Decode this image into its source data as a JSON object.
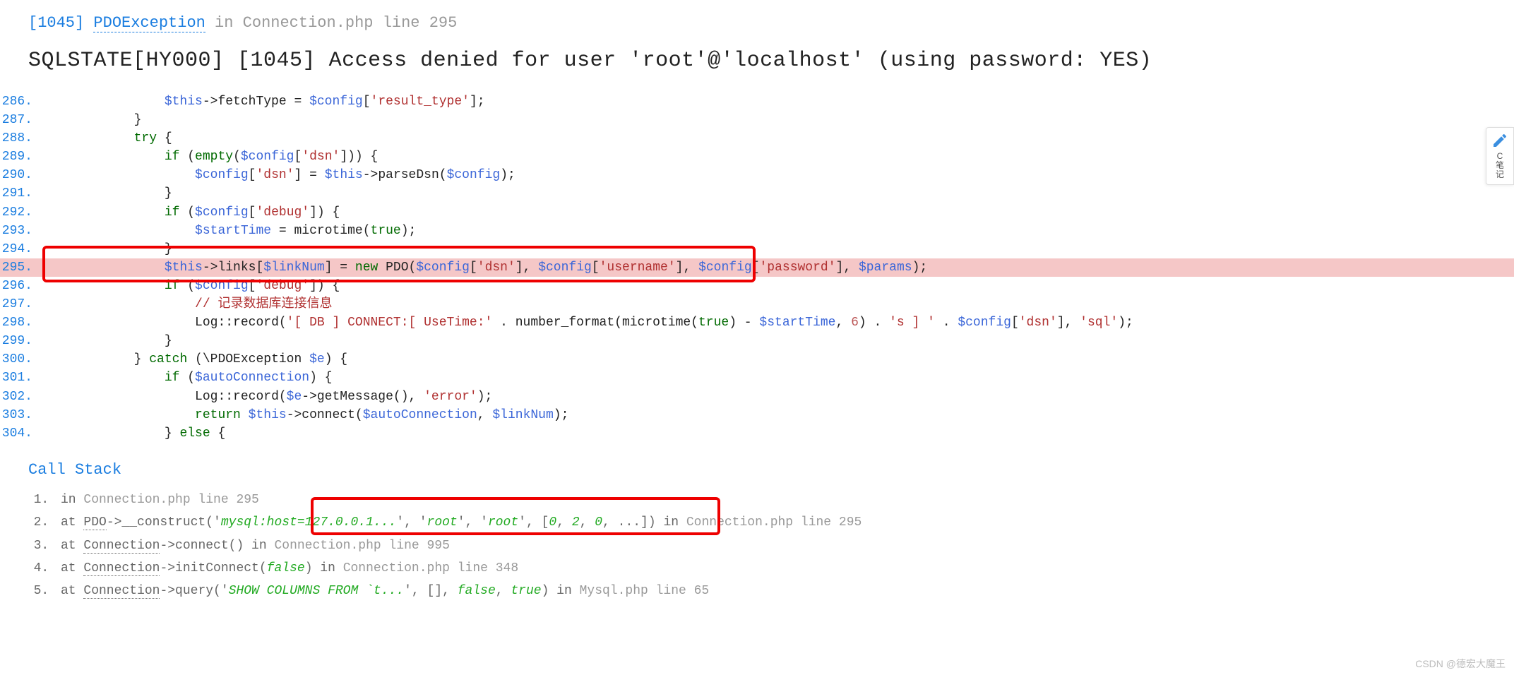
{
  "header": {
    "code": "[1045]",
    "exception": "PDOException",
    "in": " in ",
    "file_line": "Connection.php line 295"
  },
  "error_message": "SQLSTATE[HY000] [1045] Access denied for user 'root'@'localhost' (using password: YES)",
  "code_lines": [
    {
      "n": "286.",
      "indent": "                ",
      "tokens": [
        {
          "t": "var",
          "v": "$this"
        },
        {
          "t": "p",
          "v": "->fetchType = "
        },
        {
          "t": "var",
          "v": "$config"
        },
        {
          "t": "p",
          "v": "["
        },
        {
          "t": "str",
          "v": "'result_type'"
        },
        {
          "t": "p",
          "v": "];"
        }
      ]
    },
    {
      "n": "287.",
      "indent": "            ",
      "tokens": [
        {
          "t": "p",
          "v": "}"
        }
      ]
    },
    {
      "n": "288.",
      "indent": "            ",
      "tokens": [
        {
          "t": "kw",
          "v": "try"
        },
        {
          "t": "p",
          "v": " {"
        }
      ]
    },
    {
      "n": "289.",
      "indent": "                ",
      "tokens": [
        {
          "t": "kw",
          "v": "if"
        },
        {
          "t": "p",
          "v": " ("
        },
        {
          "t": "kw",
          "v": "empty"
        },
        {
          "t": "p",
          "v": "("
        },
        {
          "t": "var",
          "v": "$config"
        },
        {
          "t": "p",
          "v": "["
        },
        {
          "t": "str",
          "v": "'dsn'"
        },
        {
          "t": "p",
          "v": "])) {"
        }
      ]
    },
    {
      "n": "290.",
      "indent": "                    ",
      "tokens": [
        {
          "t": "var",
          "v": "$config"
        },
        {
          "t": "p",
          "v": "["
        },
        {
          "t": "str",
          "v": "'dsn'"
        },
        {
          "t": "p",
          "v": "] = "
        },
        {
          "t": "var",
          "v": "$this"
        },
        {
          "t": "p",
          "v": "->parseDsn("
        },
        {
          "t": "var",
          "v": "$config"
        },
        {
          "t": "p",
          "v": ");"
        }
      ]
    },
    {
      "n": "291.",
      "indent": "                ",
      "tokens": [
        {
          "t": "p",
          "v": "}"
        }
      ]
    },
    {
      "n": "292.",
      "indent": "                ",
      "tokens": [
        {
          "t": "kw",
          "v": "if"
        },
        {
          "t": "p",
          "v": " ("
        },
        {
          "t": "var",
          "v": "$config"
        },
        {
          "t": "p",
          "v": "["
        },
        {
          "t": "str",
          "v": "'debug'"
        },
        {
          "t": "p",
          "v": "]) {"
        }
      ]
    },
    {
      "n": "293.",
      "indent": "                    ",
      "tokens": [
        {
          "t": "var",
          "v": "$startTime"
        },
        {
          "t": "p",
          "v": " = microtime("
        },
        {
          "t": "kw",
          "v": "true"
        },
        {
          "t": "p",
          "v": ");"
        }
      ]
    },
    {
      "n": "294.",
      "indent": "                ",
      "tokens": [
        {
          "t": "p",
          "v": "}"
        }
      ]
    },
    {
      "n": "295.",
      "hl": true,
      "indent": "                ",
      "tokens": [
        {
          "t": "var",
          "v": "$this"
        },
        {
          "t": "p",
          "v": "->links["
        },
        {
          "t": "var",
          "v": "$linkNum"
        },
        {
          "t": "p",
          "v": "] = "
        },
        {
          "t": "kw",
          "v": "new"
        },
        {
          "t": "p",
          "v": " PDO("
        },
        {
          "t": "var",
          "v": "$config"
        },
        {
          "t": "p",
          "v": "["
        },
        {
          "t": "str",
          "v": "'dsn'"
        },
        {
          "t": "p",
          "v": "], "
        },
        {
          "t": "var",
          "v": "$config"
        },
        {
          "t": "p",
          "v": "["
        },
        {
          "t": "str",
          "v": "'username'"
        },
        {
          "t": "p",
          "v": "], "
        },
        {
          "t": "var",
          "v": "$config"
        },
        {
          "t": "p",
          "v": "["
        },
        {
          "t": "str",
          "v": "'password'"
        },
        {
          "t": "p",
          "v": "], "
        },
        {
          "t": "var",
          "v": "$params"
        },
        {
          "t": "p",
          "v": ");"
        }
      ]
    },
    {
      "n": "296.",
      "indent": "                ",
      "tokens": [
        {
          "t": "kw",
          "v": "if"
        },
        {
          "t": "p",
          "v": " ("
        },
        {
          "t": "var",
          "v": "$config"
        },
        {
          "t": "p",
          "v": "["
        },
        {
          "t": "str",
          "v": "'debug'"
        },
        {
          "t": "p",
          "v": "]) {"
        }
      ]
    },
    {
      "n": "297.",
      "indent": "                    ",
      "tokens": [
        {
          "t": "cmt",
          "v": "// 记录数据库连接信息"
        }
      ]
    },
    {
      "n": "298.",
      "indent": "                    ",
      "tokens": [
        {
          "t": "p",
          "v": "Log::record("
        },
        {
          "t": "str",
          "v": "'[ DB ] CONNECT:[ UseTime:'"
        },
        {
          "t": "p",
          "v": " . number_format(microtime("
        },
        {
          "t": "kw",
          "v": "true"
        },
        {
          "t": "p",
          "v": ") - "
        },
        {
          "t": "var",
          "v": "$startTime"
        },
        {
          "t": "p",
          "v": ", "
        },
        {
          "t": "num",
          "v": "6"
        },
        {
          "t": "p",
          "v": ") . "
        },
        {
          "t": "str",
          "v": "'s ] '"
        },
        {
          "t": "p",
          "v": " . "
        },
        {
          "t": "var",
          "v": "$config"
        },
        {
          "t": "p",
          "v": "["
        },
        {
          "t": "str",
          "v": "'dsn'"
        },
        {
          "t": "p",
          "v": "], "
        },
        {
          "t": "str",
          "v": "'sql'"
        },
        {
          "t": "p",
          "v": ");"
        }
      ]
    },
    {
      "n": "299.",
      "indent": "                ",
      "tokens": [
        {
          "t": "p",
          "v": "}"
        }
      ]
    },
    {
      "n": "300.",
      "indent": "            ",
      "tokens": [
        {
          "t": "p",
          "v": "} "
        },
        {
          "t": "kw",
          "v": "catch"
        },
        {
          "t": "p",
          "v": " (\\PDOException "
        },
        {
          "t": "var",
          "v": "$e"
        },
        {
          "t": "p",
          "v": ") {"
        }
      ]
    },
    {
      "n": "301.",
      "indent": "                ",
      "tokens": [
        {
          "t": "kw",
          "v": "if"
        },
        {
          "t": "p",
          "v": " ("
        },
        {
          "t": "var",
          "v": "$autoConnection"
        },
        {
          "t": "p",
          "v": ") {"
        }
      ]
    },
    {
      "n": "302.",
      "indent": "                    ",
      "tokens": [
        {
          "t": "p",
          "v": "Log::record("
        },
        {
          "t": "var",
          "v": "$e"
        },
        {
          "t": "p",
          "v": "->getMessage(), "
        },
        {
          "t": "str",
          "v": "'error'"
        },
        {
          "t": "p",
          "v": ");"
        }
      ]
    },
    {
      "n": "303.",
      "indent": "                    ",
      "tokens": [
        {
          "t": "kw",
          "v": "return"
        },
        {
          "t": "p",
          "v": " "
        },
        {
          "t": "var",
          "v": "$this"
        },
        {
          "t": "p",
          "v": "->connect("
        },
        {
          "t": "var",
          "v": "$autoConnection"
        },
        {
          "t": "p",
          "v": ", "
        },
        {
          "t": "var",
          "v": "$linkNum"
        },
        {
          "t": "p",
          "v": ");"
        }
      ]
    },
    {
      "n": "304.",
      "indent": "                ",
      "tokens": [
        {
          "t": "p",
          "v": "} "
        },
        {
          "t": "kw",
          "v": "else"
        },
        {
          "t": "p",
          "v": " {"
        }
      ]
    }
  ],
  "callstack": {
    "title": "Call Stack",
    "items": [
      {
        "html": "in <span class='csfile'>Connection.php line 295</span>"
      },
      {
        "html": "at <span class='dotted'>PDO</span>->__construct('<span class='csvar'>mysql:host=127.0.0.1...</span>', '<span class='csvar'>root</span>', '<span class='csvar'>root</span>', [<span class='csvar'>0</span>, <span class='csvar'>2</span>, <span class='csvar'>0</span>, ...]) in <span class='csfile'>Connection.php line 295</span>"
      },
      {
        "html": "at <span class='dotted'>Connection</span>->connect() in <span class='csfile'>Connection.php line 995</span>"
      },
      {
        "html": "at <span class='dotted'>Connection</span>->initConnect(<span class='csvar'>false</span>) in <span class='csfile'>Connection.php line 348</span>"
      },
      {
        "html": "at <span class='dotted'>Connection</span>->query('<span class='csvar'>SHOW COLUMNS FROM `t...</span>', [], <span class='csvar'>false</span>, <span class='csvar'>true</span>) in <span class='csfile'>Mysql.php line 65</span>"
      }
    ]
  },
  "sidebar": {
    "line1": "C",
    "line2": "笔",
    "line3": "记"
  },
  "watermark": "CSDN @德宏大魔王"
}
